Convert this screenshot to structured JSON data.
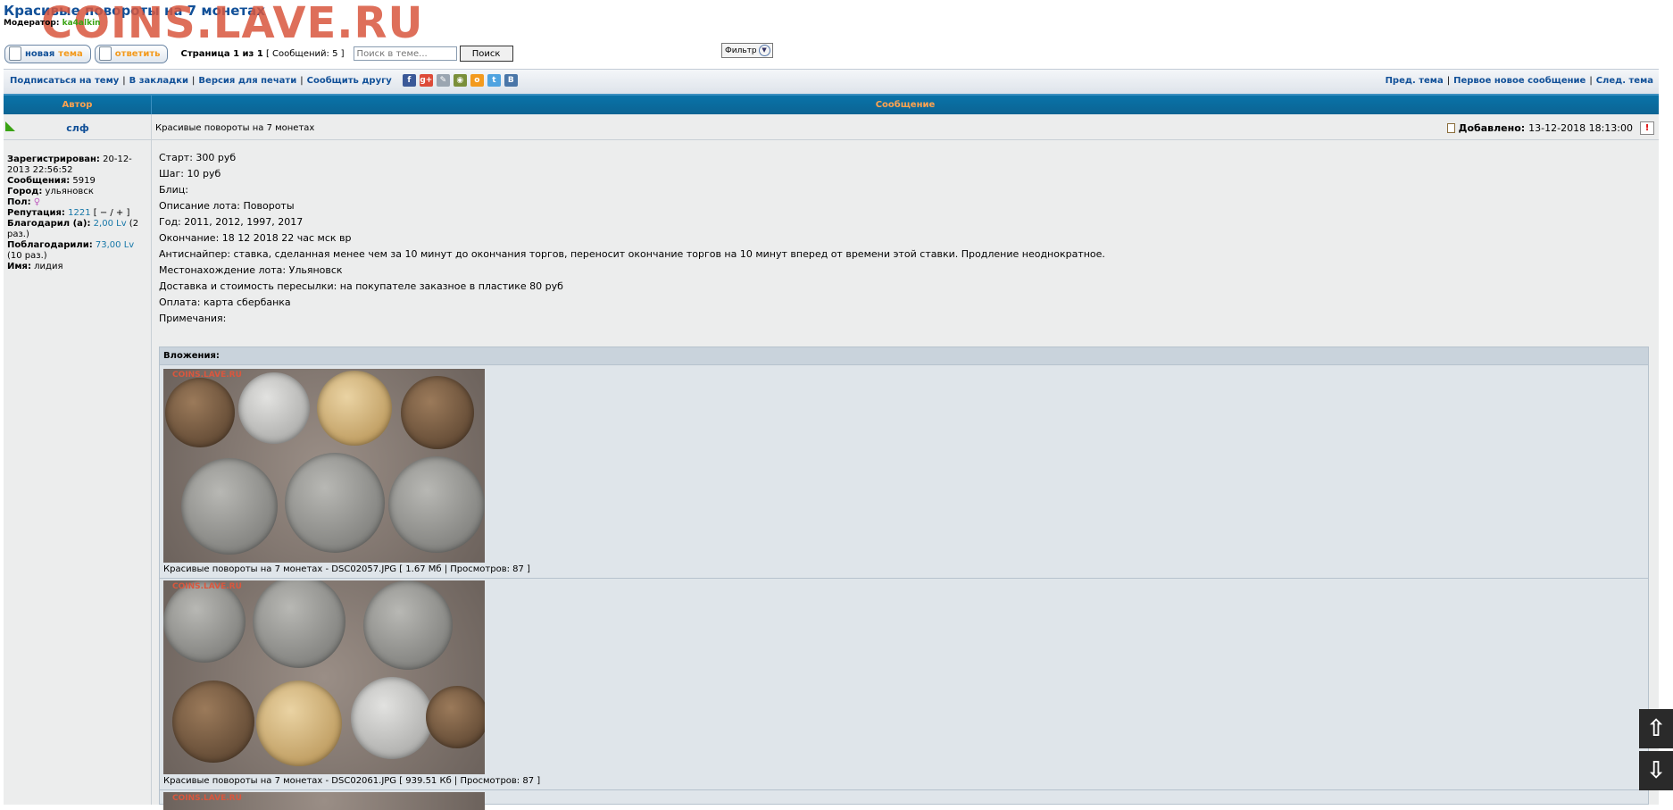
{
  "topic": {
    "title": "Красивые повороты на 7 монетах",
    "watermark": "COINS.LAVE.RU",
    "moderator_label": "Модератор:",
    "moderator_name": "ka4alkin"
  },
  "actions": {
    "new_topic_w1": "новая",
    "new_topic_w2": "тема",
    "reply_label": "ответить",
    "page_label": "Страница 1 из 1",
    "post_count": "[ Сообщений: 5 ]",
    "search_placeholder": "Поиск в теме...",
    "search_button": "Поиск",
    "filter_button": "Фильтр"
  },
  "navbar": {
    "subscribe": "Подписаться на тему",
    "bookmark": "В закладки",
    "print": "Версия для печати",
    "tell_friend": "Сообщить другу",
    "share_icons": [
      "f",
      "g+",
      "✎",
      "◉",
      "о",
      "t",
      "В"
    ],
    "prev_topic": "Пред. тема",
    "first_new": "Первое новое сообщение",
    "next_topic": "След. тема",
    "separator": "|"
  },
  "table_header": {
    "author": "Автор",
    "message": "Сообщение"
  },
  "author": {
    "name": "слф",
    "registered_label": "Зарегистрирован:",
    "registered_value": "20-12-2013 22:56:52",
    "posts_label": "Сообщения:",
    "posts_value": "5919",
    "city_label": "Город:",
    "city_value": "ульяновск",
    "gender_label": "Пол:",
    "gender_value": "♀",
    "reputation_label": "Репутация:",
    "reputation_value": "1221",
    "reputation_controls": "[ − / + ]",
    "thanked_label": "Благодарил (а):",
    "thanked_value": "2,00 Lv",
    "thanked_times": "(2 раз.)",
    "got_thanks_label": "Поблагодарили:",
    "got_thanks_value": "73,00 Lv",
    "got_thanks_times": "(10 раз.)",
    "name_label": "Имя:",
    "name_value": "лидия"
  },
  "post": {
    "subject": "Красивые повороты на 7 монетах",
    "added_label": "Добавлено:",
    "added_date": "13-12-2018 18:13:00",
    "report_icon": "!",
    "lines": [
      "Старт: 300 руб",
      "Шаг: 10 руб",
      "Блиц:",
      "Описание лота: Повороты",
      "Год: 2011, 2012, 1997, 2017",
      "Окончание: 18 12 2018 22 час мск вр",
      "Антиснайпер: ставка, сделанная менее чем за 10 минут до окончания торгов, переносит окончание торгов на 10 минут вперед от времени этой ставки. Продление неоднократное.",
      "Местонахождение лота: Ульяновск",
      "Доставка и стоимость пересылки: на покупателе заказное в пластике 80 руб",
      "Оплата: карта сбербанка",
      "Примечания:"
    ]
  },
  "attachments": {
    "title": "Вложения:",
    "image_watermark": "COINS.LAVE.RU",
    "items": [
      {
        "caption": "Красивые повороты на 7 монетах - DSC02057.JPG [ 1.67 Мб | Просмотров: 87 ]"
      },
      {
        "caption": "Красивые повороты на 7 монетах - DSC02061.JPG [ 939.51 Кб | Просмотров: 87 ]"
      }
    ]
  },
  "scroll": {
    "up_icon": "⇧",
    "down_icon": "⇩"
  },
  "colors": {
    "link_blue": "#115098",
    "header_bg": "#0b6b9e",
    "header_text": "#ffa34f",
    "panel_bg": "#eceded",
    "moderator_green": "#3aa314"
  }
}
